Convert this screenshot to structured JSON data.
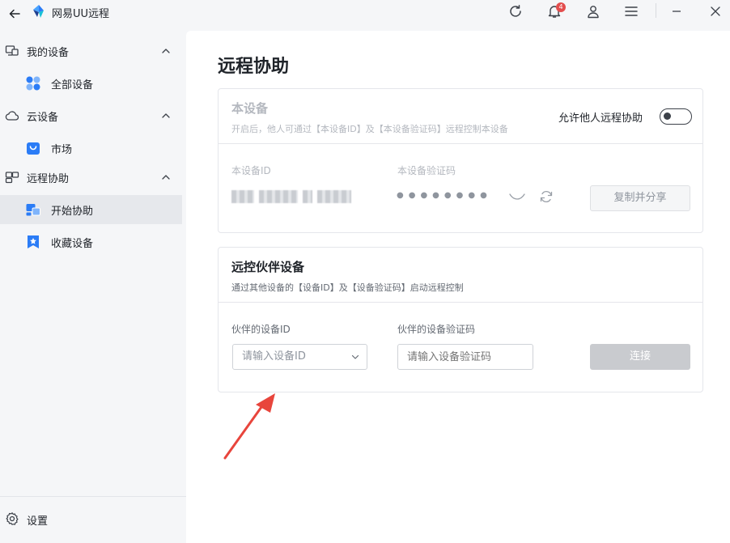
{
  "titlebar": {
    "app_title": "网易UU远程",
    "notification_count": "4",
    "icons": [
      "back-arrow-icon",
      "app-logo-icon",
      "refresh-icon",
      "bell-icon",
      "user-icon",
      "menu-icon",
      "minimize-icon",
      "close-icon"
    ]
  },
  "sidebar": {
    "groups": [
      {
        "label": "我的设备",
        "icon": "monitor-icon",
        "items": [
          {
            "label": "全部设备",
            "icon": "grid-icon"
          }
        ]
      },
      {
        "label": "云设备",
        "icon": "cloud-icon",
        "items": [
          {
            "label": "市场",
            "icon": "bag-icon"
          }
        ]
      },
      {
        "label": "远程协助",
        "icon": "remote-icon",
        "items": [
          {
            "label": "开始协助",
            "icon": "assist-icon",
            "active": true
          },
          {
            "label": "收藏设备",
            "icon": "star-bookmark-icon"
          }
        ]
      }
    ],
    "settings_label": "设置"
  },
  "main": {
    "page_title": "远程协助",
    "this_device": {
      "title": "本设备",
      "desc": "开启后，他人可通过【本设备ID】及【本设备验证码】远程控制本设备",
      "toggle_label": "允许他人远程协助",
      "toggle_on": false,
      "id_label": "本设备ID",
      "code_label": "本设备验证码",
      "code_masked": "●●●●●●●●",
      "copy_button": "复制并分享"
    },
    "partner": {
      "title": "远控伙伴设备",
      "desc": "通过其他设备的【设备ID】及【设备验证码】启动远程控制",
      "id_label": "伙伴的设备ID",
      "code_label": "伙伴的设备验证码",
      "id_placeholder": "请输入设备ID",
      "code_placeholder": "请输入设备验证码",
      "connect_button": "连接"
    }
  },
  "colors": {
    "accent_blue": "#2b7cf6",
    "annotation_arrow": "#e8453c",
    "disabled_button": "#c9cbcf"
  }
}
